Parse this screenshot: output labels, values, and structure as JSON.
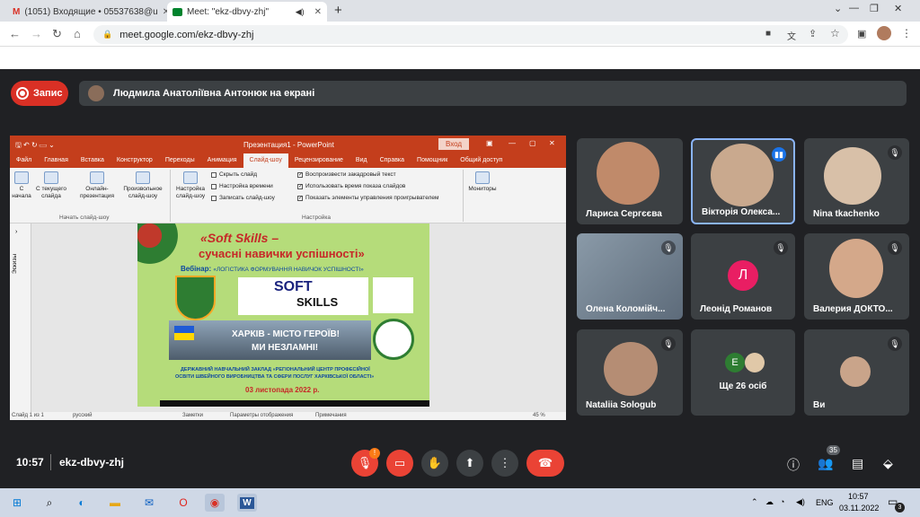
{
  "browser": {
    "tabs": [
      {
        "title": "(1051) Входящие • 05537638@u",
        "icon": "gmail-icon"
      },
      {
        "title": "Meet: \"ekz-dbvy-zhj\"",
        "icon": "meet-icon"
      }
    ],
    "new_tab": "+",
    "url": "meet.google.com/ekz-dbvy-zhj"
  },
  "meet": {
    "record_label": "Запис",
    "presenter_text": "Людмила Анатоліївна Антонюк на екрані",
    "time": "10:57",
    "meeting_code": "ekz-dbvy-zhj",
    "participants_badge": "35",
    "colors": {
      "bg": "#202124",
      "tile": "#3c4043",
      "red": "#ea4335",
      "blue_border": "#8ab4f8"
    }
  },
  "ppt": {
    "title": "Презентация1 - PowerPoint",
    "login": "Вход",
    "menu": [
      "Файл",
      "Главная",
      "Вставка",
      "Конструктор",
      "Переходы",
      "Анимация",
      "Слайд-шоу",
      "Рецензирование",
      "Вид",
      "Справка",
      "Помощник",
      "Общий доступ"
    ],
    "active_menu": "Слайд-шоу",
    "ribbon": {
      "btn_from_start": "С начала",
      "btn_from_current": "С текущего слайда",
      "btn_online": "Онлайн-презентация",
      "btn_custom": "Произвольное слайд-шоу",
      "group_start": "Начать слайд-шоу",
      "btn_setup": "Настройка слайд-шоу",
      "hide_slide": "Скрыть слайд",
      "rehearse": "Настройка времени",
      "record": "Записать слайд-шоу",
      "chk1": "Воспроизвести закадровый текст",
      "chk2": "Использовать время показа слайдов",
      "chk3": "Показать элементы управления проигрывателем",
      "group_setup": "Настройка",
      "monitors": "Мониторы"
    },
    "sketches": "Эскизы",
    "status": {
      "slide": "Слайд 1 из 1",
      "lang": "русский",
      "notes": "Заметки",
      "display": "Параметры отображения",
      "comments": "Примечания",
      "zoom": "45 %"
    }
  },
  "slide": {
    "title1": "«Soft Skills –",
    "title2": "сучасні навички успішності»",
    "webinar_label": "Вебінар:",
    "webinar_topic": "«ЛОГІСТИКА ФОРМУВАННЯ НАВИЧОК УСПІШНОСТІ»",
    "soft": "SOFT",
    "skills": "SKILLS",
    "kharkiv1": "ХАРКІВ - МІСТО ГЕРОЇВ!",
    "kharkiv2": "МИ НЕЗЛАМНІ!",
    "org1": "ДЕРЖАВНИЙ НАВЧАЛЬНИЙ ЗАКЛАД «РЕГІОНАЛЬНИЙ ЦЕНТР ПРОФЕСІЙНОЇ",
    "org2": "ОСВІТИ ШВЕЙНОГО ВИРОБНИЦТВА ТА СФЕРИ ПОСЛУГ ХАРКІВСЬКОЇ ОБЛАСТІ»",
    "date": "03 листопада 2022 р."
  },
  "tiles": [
    {
      "name": "Лариса Сергєєва"
    },
    {
      "name": "Вікторія Олекса..."
    },
    {
      "name": "Nina tkachenko"
    },
    {
      "name": "Олена Коломійч..."
    },
    {
      "name": "Леонід Романов",
      "initial": "Л"
    },
    {
      "name": "Валерия ДОКТО..."
    },
    {
      "name": "Nataliia Sologub"
    },
    {
      "name": "Ще 26 осіб",
      "initial": "Е"
    },
    {
      "name": "Ви"
    }
  ],
  "taskbar": {
    "lang": "ENG",
    "time": "10:57",
    "date": "03.11.2022",
    "notif": "3"
  }
}
